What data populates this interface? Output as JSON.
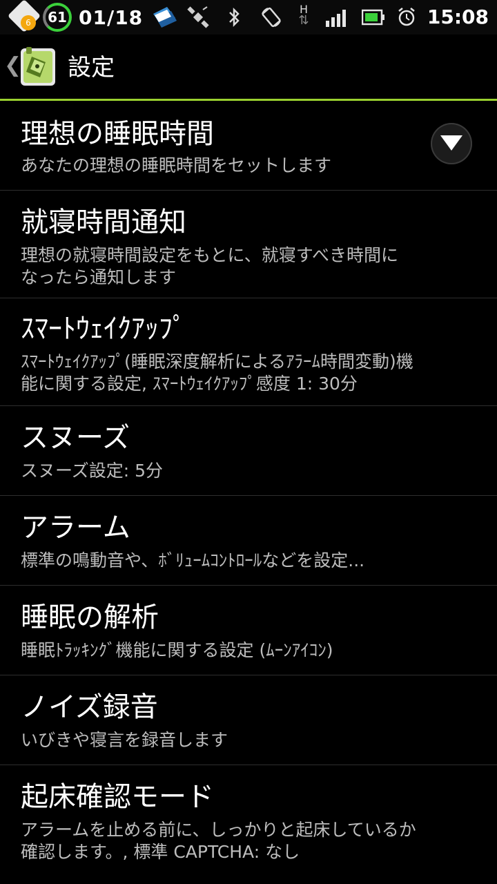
{
  "status_bar": {
    "notification_count": "6",
    "battery_level": "61",
    "date": "01/18",
    "time": "15:08",
    "icons": [
      "notification-icon",
      "battery-ring-icon",
      "folder-mail-icon",
      "satellite-icon",
      "bluetooth-icon",
      "rotation-lock-icon",
      "hspa-data-icon",
      "signal-icon",
      "battery-icon",
      "alarm-clock-icon"
    ],
    "network_type": "H"
  },
  "header": {
    "title": "設定",
    "app_icon": "sleep-as-android-app-icon"
  },
  "colors": {
    "accent": "#9ad12f",
    "battery_ring": "#3bd13b",
    "notification_badge": "#f4a70f"
  },
  "settings": [
    {
      "title": "理想の睡眠時間",
      "summary": "あなたの理想の睡眠時間をセットします",
      "has_dropdown": true
    },
    {
      "title": "就寝時間通知",
      "summary": "理想の就寝時間設定をもとに、就寝すべき時間に\nなったら通知します"
    },
    {
      "title": "ｽﾏｰﾄｳｪｲｸｱｯﾌﾟ",
      "summary": "ｽﾏｰﾄｳｪｲｸｱｯﾌﾟ(睡眠深度解析によるｱﾗｰﾑ時間変動)機\n能に関する設定, ｽﾏｰﾄｳｪｲｸｱｯﾌﾟ感度 1: 30分"
    },
    {
      "title": "スヌーズ",
      "summary": "スヌーズ設定: 5分"
    },
    {
      "title": "アラーム",
      "summary": "標準の鳴動音や、ﾎﾞﾘｭｰﾑｺﾝﾄﾛｰﾙなどを設定..."
    },
    {
      "title": "睡眠の解析",
      "summary": "睡眠ﾄﾗｯｷﾝｸﾞ機能に関する設定 (ﾑｰﾝｱｲｺﾝ)"
    },
    {
      "title": "ノイズ録音",
      "summary": "いびきや寝言を録音します"
    },
    {
      "title": "起床確認モード",
      "summary": "アラームを止める前に、しっかりと起床しているか\n確認します。, 標準 CAPTCHA: なし"
    }
  ]
}
